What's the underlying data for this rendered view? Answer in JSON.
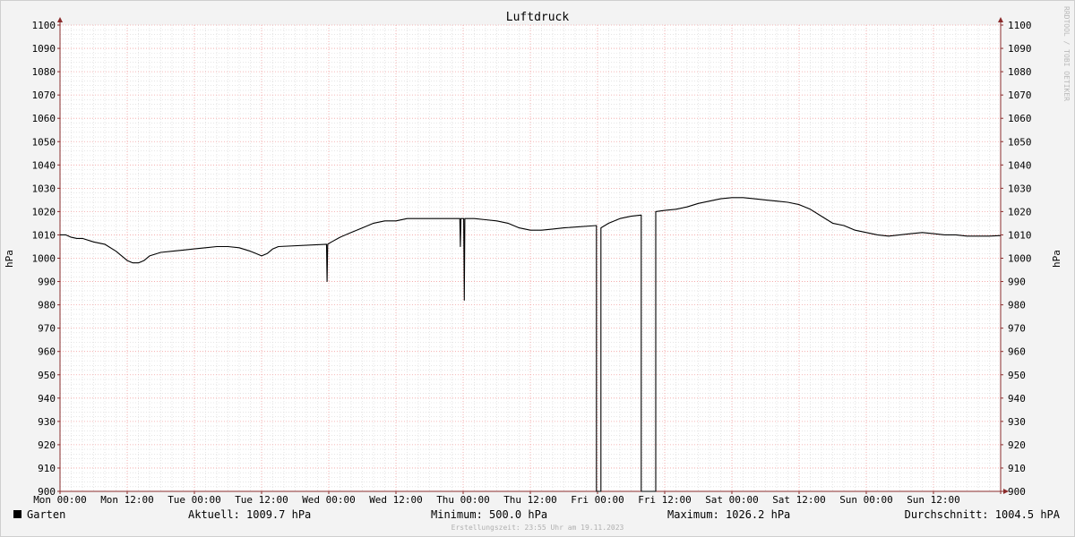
{
  "colors": {
    "background": "#f3f3f3",
    "plot_bg": "#ffffff",
    "major_grid": "#f2a0a0",
    "minor_grid": "#d6d6d6",
    "line": "#000000",
    "axis": "#8a2b2b"
  },
  "watermark": "RRDTOOL / TOBI OETIKER",
  "legend": {
    "series_name": "Garten",
    "current": "Aktuell: 1009.7 hPa",
    "minimum": "Minimum: 500.0 hPa",
    "maximum": "Maximum: 1026.2 hPa",
    "average": "Durchschnitt: 1004.5 hPA"
  },
  "footer": "Erstellungszeit: 23:55 Uhr am 19.11.2023",
  "chart_data": {
    "type": "line",
    "title": "Luftdruck",
    "ylabel": "hPa",
    "ylabel_right": "hPa",
    "ylim": [
      900,
      1100
    ],
    "xlim": [
      0,
      168
    ],
    "x_unit": "hours since Mon 00:00",
    "grid": true,
    "yticks": [
      900,
      910,
      920,
      930,
      940,
      950,
      960,
      970,
      980,
      990,
      1000,
      1010,
      1020,
      1030,
      1040,
      1050,
      1060,
      1070,
      1080,
      1090,
      1100
    ],
    "xticks": [
      {
        "x": 0,
        "label": "Mon 00:00"
      },
      {
        "x": 12,
        "label": "Mon 12:00"
      },
      {
        "x": 24,
        "label": "Tue 00:00"
      },
      {
        "x": 36,
        "label": "Tue 12:00"
      },
      {
        "x": 48,
        "label": "Wed 00:00"
      },
      {
        "x": 60,
        "label": "Wed 12:00"
      },
      {
        "x": 72,
        "label": "Thu 00:00"
      },
      {
        "x": 84,
        "label": "Thu 12:00"
      },
      {
        "x": 96,
        "label": "Fri 00:00"
      },
      {
        "x": 108,
        "label": "Fri 12:00"
      },
      {
        "x": 120,
        "label": "Sat 00:00"
      },
      {
        "x": 132,
        "label": "Sat 12:00"
      },
      {
        "x": 144,
        "label": "Sun 00:00"
      },
      {
        "x": 156,
        "label": "Sun 12:00"
      }
    ],
    "series": [
      {
        "name": "Garten",
        "color": "#000000",
        "points": [
          [
            0,
            1010
          ],
          [
            1,
            1010
          ],
          [
            2,
            1009
          ],
          [
            3,
            1008.5
          ],
          [
            4,
            1008.5
          ],
          [
            6,
            1007
          ],
          [
            8,
            1006
          ],
          [
            10,
            1003
          ],
          [
            12,
            999
          ],
          [
            13,
            998
          ],
          [
            14,
            998
          ],
          [
            15,
            999
          ],
          [
            16,
            1001
          ],
          [
            18,
            1002.5
          ],
          [
            20,
            1003
          ],
          [
            22,
            1003.5
          ],
          [
            24,
            1004
          ],
          [
            26,
            1004.5
          ],
          [
            28,
            1005
          ],
          [
            30,
            1005
          ],
          [
            32,
            1004.5
          ],
          [
            34,
            1003
          ],
          [
            35,
            1002
          ],
          [
            36,
            1001
          ],
          [
            37,
            1002
          ],
          [
            38,
            1004
          ],
          [
            39,
            1005
          ],
          [
            47.6,
            1006
          ],
          [
            47.7,
            990
          ],
          [
            47.8,
            1006
          ],
          [
            48.5,
            1007
          ],
          [
            50,
            1009
          ],
          [
            52,
            1011
          ],
          [
            54,
            1013
          ],
          [
            56,
            1015
          ],
          [
            58,
            1016
          ],
          [
            60,
            1016
          ],
          [
            62,
            1017
          ],
          [
            64,
            1017
          ],
          [
            71.4,
            1017
          ],
          [
            71.5,
            1005
          ],
          [
            71.6,
            1017
          ],
          [
            72.1,
            1017
          ],
          [
            72.2,
            982
          ],
          [
            72.3,
            1017
          ],
          [
            74,
            1017
          ],
          [
            76,
            1016.5
          ],
          [
            78,
            1016
          ],
          [
            80,
            1015
          ],
          [
            82,
            1013
          ],
          [
            84,
            1012
          ],
          [
            86,
            1012
          ],
          [
            88,
            1012.5
          ],
          [
            90,
            1013
          ],
          [
            95.8,
            1014
          ],
          [
            95.8,
            900
          ],
          [
            96.6,
            900
          ],
          [
            96.6,
            1013
          ],
          [
            98,
            1015
          ],
          [
            100,
            1017
          ],
          [
            102,
            1018
          ],
          [
            103.8,
            1018.5
          ],
          [
            103.8,
            900
          ],
          [
            106.4,
            900
          ],
          [
            106.4,
            1020
          ],
          [
            108,
            1020.5
          ],
          [
            110,
            1021
          ],
          [
            112,
            1022
          ],
          [
            114,
            1023.5
          ],
          [
            116,
            1024.5
          ],
          [
            118,
            1025.5
          ],
          [
            120,
            1026
          ],
          [
            122,
            1026
          ],
          [
            124,
            1025.5
          ],
          [
            126,
            1025
          ],
          [
            128,
            1024.5
          ],
          [
            130,
            1024
          ],
          [
            132,
            1023
          ],
          [
            134,
            1021
          ],
          [
            136,
            1018
          ],
          [
            138,
            1015
          ],
          [
            140,
            1014
          ],
          [
            142,
            1012
          ],
          [
            144,
            1011
          ],
          [
            146,
            1010
          ],
          [
            148,
            1009.5
          ],
          [
            150,
            1010
          ],
          [
            152,
            1010.5
          ],
          [
            154,
            1011
          ],
          [
            156,
            1010.5
          ],
          [
            158,
            1010
          ],
          [
            160,
            1010
          ],
          [
            162,
            1009.5
          ],
          [
            164,
            1009.5
          ],
          [
            166,
            1009.5
          ],
          [
            168,
            1009.7
          ]
        ]
      }
    ]
  }
}
